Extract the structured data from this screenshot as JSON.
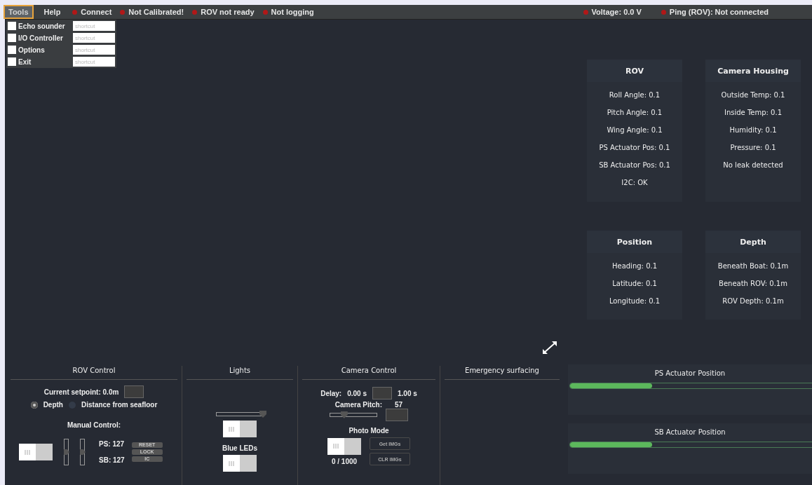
{
  "menu": [
    {
      "label": "Tools",
      "selected": true
    },
    {
      "label": "Help",
      "selected": false
    }
  ],
  "status_left": [
    {
      "label": "Connect",
      "ok": false
    },
    {
      "label": "Not Calibrated!",
      "ok": false
    },
    {
      "label": "ROV not ready",
      "ok": false
    },
    {
      "label": "Not logging",
      "ok": false
    }
  ],
  "status_right": [
    {
      "label": "Voltage: 0.0 V",
      "ok": false
    },
    {
      "label": "Ping (ROV): Not connected",
      "ok": false
    }
  ],
  "dropdown": [
    {
      "label": "Echo sounder",
      "checked": false,
      "placeholder": "shortcut"
    },
    {
      "label": "I/O Controller",
      "checked": false,
      "placeholder": "shortcut"
    },
    {
      "label": "Options",
      "checked": false,
      "placeholder": "shortcut"
    },
    {
      "label": "Exit",
      "checked": false,
      "placeholder": "shortcut"
    }
  ],
  "panels": [
    {
      "title": "ROV",
      "lines": [
        "Roll Angle: 0.1",
        "Pitch Angle: 0.1",
        "Wing Angle: 0.1",
        "PS Actuator Pos: 0.1",
        "SB Actuator Pos: 0.1",
        "I2C: OK"
      ]
    },
    {
      "title": "Camera Housing",
      "lines": [
        "Outside Temp: 0.1",
        "Inside Temp: 0.1",
        "Humidity: 0.1",
        "Pressure: 0.1",
        "No leak detected"
      ]
    },
    {
      "title": "Position",
      "lines": [
        "Heading: 0.1",
        "Latitude: 0.1",
        "Longitude: 0.1"
      ]
    },
    {
      "title": "Depth",
      "lines": [
        "Beneath Boat: 0.1m",
        "Beneath ROV: 0.1m",
        "ROV Depth: 0.1m"
      ]
    }
  ],
  "rov_control": {
    "title": "ROV Control",
    "setpoint": "Current setpoint: 0.0m",
    "radios": [
      {
        "label": "Depth",
        "selected": true
      },
      {
        "label": "Distance from seafloor",
        "selected": false
      }
    ],
    "manual_label": "Manual Control:",
    "toggle": {
      "on": false
    },
    "sliders": [
      {
        "level": 0.5
      },
      {
        "level": 0.5
      }
    ],
    "ps": "PS: 127",
    "sb": "SB: 127",
    "buttons": [
      "RESET",
      "LOCK",
      "IC"
    ]
  },
  "lights": {
    "title": "Lights",
    "slider": {
      "level": 1.0
    },
    "toggle": {
      "on": false
    },
    "blue_label": "Blue LEDs",
    "blue_toggle": {
      "on": false
    }
  },
  "camera_control": {
    "title": "Camera Control",
    "delay_label": "Delay:",
    "delay_min": "0.00 s",
    "delay_max": "1.00 s",
    "pitch_label": "Camera Pitch:",
    "pitch_value": "57",
    "pitch_slider": {
      "level": 0.3
    },
    "photo_label": "Photo Mode",
    "photo_toggle": {
      "on": false
    },
    "count": "0 / 1000",
    "buttons": [
      "Get IMGs",
      "CLR IMGs"
    ]
  },
  "emergency": {
    "title": "Emergency surfacing"
  },
  "actuators": [
    {
      "title": "PS Actuator Position",
      "level": 0.33
    },
    {
      "title": "SB Actuator Position",
      "level": 0.33
    }
  ]
}
